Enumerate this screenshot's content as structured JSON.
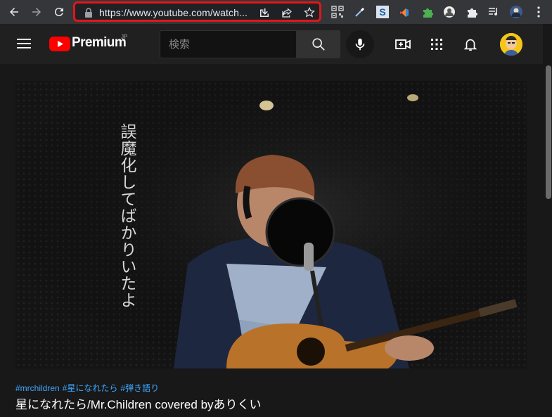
{
  "browser": {
    "url": "https://www.youtube.com/watch...",
    "back_icon": "arrow-left-icon",
    "forward_icon": "arrow-right-icon",
    "reload_icon": "reload-icon",
    "accent_highlight": "#e0171b"
  },
  "youtube": {
    "logo_text": "Premium",
    "region": "JP",
    "search_placeholder": "検索"
  },
  "video": {
    "overlay_caption": "誤魔化してばかりいたよ",
    "hashtags": [
      "#mrchildren",
      "#星になれたら",
      "#弾き語り"
    ],
    "title": "星になれたら/Mr.Children covered byありくい"
  },
  "colors": {
    "youtube_red": "#ff0000",
    "hashtag_blue": "#3ea6ff",
    "header_bg": "#202020"
  }
}
